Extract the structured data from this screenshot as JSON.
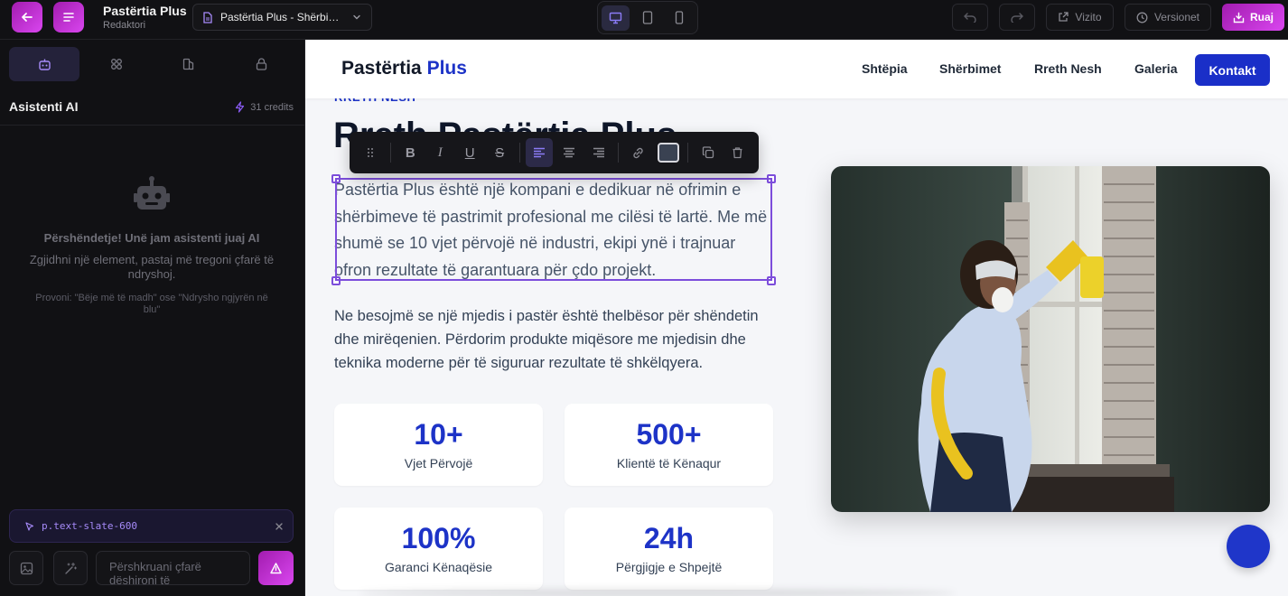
{
  "topbar": {
    "project_title": "Pastërtia Plus",
    "project_subtitle": "Redaktori",
    "page_select_label": "Pastërtia Plus - Shërbi…",
    "visit_label": "Vizito",
    "versions_label": "Versionet",
    "save_label": "Ruaj",
    "icons": {
      "back": "arrow-left-icon",
      "menu": "menu-lines-icon",
      "page": "document-icon",
      "chevron": "chevron-down-icon",
      "desktop": "monitor-icon",
      "tablet": "tablet-icon",
      "mobile": "phone-icon",
      "undo": "undo-icon",
      "redo": "redo-icon",
      "visit": "external-link-icon",
      "versions": "clock-icon",
      "save": "save-tray-icon"
    },
    "active_device": "desktop"
  },
  "sidebar": {
    "tabs": [
      {
        "icon": "robot-icon",
        "active": true
      },
      {
        "icon": "grid-icon",
        "active": false
      },
      {
        "icon": "shapes-icon",
        "active": false
      },
      {
        "icon": "lock-icon",
        "active": false
      }
    ],
    "title": "Asistenti AI",
    "credits": "31 credits",
    "greeting": "Përshëndetje! Unë jam asistenti juaj AI",
    "greeting_sub": "Zgjidhni një element, pastaj më tregoni çfarë të ndryshoj.",
    "greeting_try": "Provoni: \"Bëje më të madh\" ose \"Ndrysho ngjyrën në blu\"",
    "selected_element": "p.text-slate-600",
    "prompt_placeholder": "Përshkruani çfarë dëshironi të",
    "accent_color": "#a21caf"
  },
  "site": {
    "brand_main": "Pastërtia",
    "brand_accent": "Plus",
    "nav": [
      "Shtëpia",
      "Shërbimet",
      "Rreth Nesh",
      "Galeria"
    ],
    "nav_cta": "Kontakt",
    "eyebrow": "RRETH NESH",
    "about_title": "Rreth Pastërtia Plus",
    "paragraph_selected": "Pastërtia Plus është një kompani e dedikuar në ofrimin e shërbimeve të pastrimit profesional me cilësi të lartë. Me më shumë se 10 vjet përvojë në industri, ekipi ynë i trajnuar ofron rezultate të garantuara për çdo projekt.",
    "paragraph_two": "Ne besojmë se një mjedis i pastër është thelbësor për shëndetin dhe mirëqenien. Përdorim produkte miqësore me mjedisin dhe teknika moderne për të siguruar rezultate të shkëlqyera.",
    "stats": [
      {
        "number": "10+",
        "label": "Vjet Përvojë"
      },
      {
        "number": "500+",
        "label": "Klientë të Kënaqur"
      },
      {
        "number": "100%",
        "label": "Garanci Kënaqësie"
      },
      {
        "number": "24h",
        "label": "Përgjigje e Shpejtë"
      }
    ],
    "brand_color": "#1d33c7"
  },
  "format_toolbar": {
    "items": [
      "drag-handle-icon",
      "bold-icon",
      "italic-icon",
      "underline-icon",
      "strikethrough-icon",
      "align-left-icon",
      "align-center-icon",
      "align-right-icon",
      "link-icon",
      "color-swatch",
      "duplicate-icon",
      "trash-icon"
    ],
    "bold_glyph": "B",
    "italic_glyph": "I",
    "underline_glyph": "U",
    "strike_glyph": "S",
    "active": "align-left-icon"
  }
}
